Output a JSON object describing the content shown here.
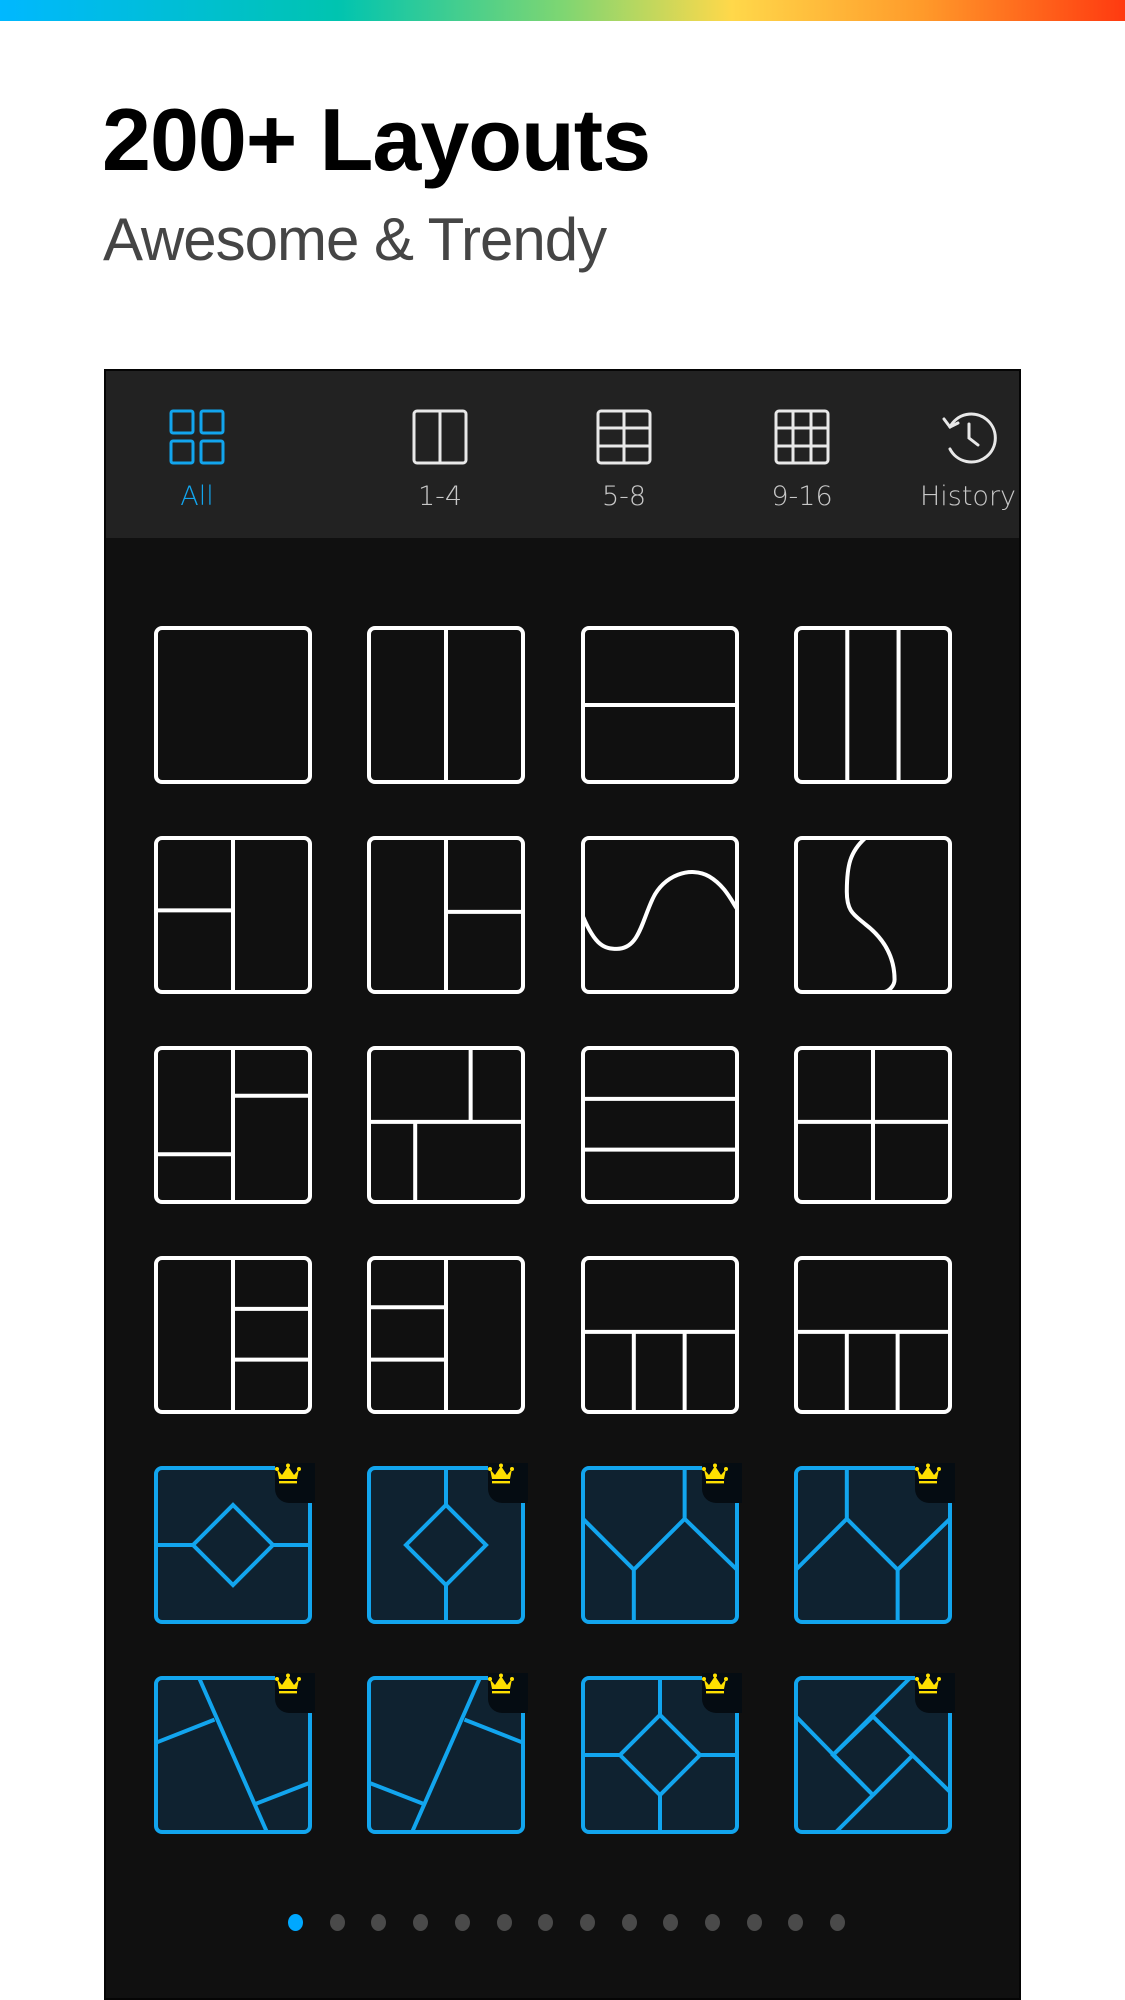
{
  "header": {
    "title": "200+ Layouts",
    "subtitle": "Awesome & Trendy"
  },
  "colors": {
    "accent": "#12a5ee",
    "premium_tile_fill": "#0f2230",
    "free_tile_stroke": "#ffffff",
    "crown": "#ffe000",
    "panel_bg": "#101010",
    "tabbar_bg": "#222222",
    "dot_inactive": "#4a4a4a",
    "dot_active": "#00a8ff"
  },
  "tabs": [
    {
      "label": "All",
      "icon": "grid-2x2-icon",
      "active": true
    },
    {
      "label": "1-4",
      "icon": "grid-1x2-icon",
      "active": false
    },
    {
      "label": "5-8",
      "icon": "grid-2x3-icon",
      "active": false
    },
    {
      "label": "9-16",
      "icon": "grid-3x3-icon",
      "active": false
    },
    {
      "label": "History",
      "icon": "history-clock-icon",
      "active": false
    }
  ],
  "layouts": [
    {
      "id": "single",
      "premium": false
    },
    {
      "id": "two-columns",
      "premium": false
    },
    {
      "id": "two-rows",
      "premium": false
    },
    {
      "id": "three-columns",
      "premium": false
    },
    {
      "id": "left-split-right-full",
      "premium": false
    },
    {
      "id": "left-full-right-split",
      "premium": false
    },
    {
      "id": "wave-horizontal",
      "premium": false
    },
    {
      "id": "wave-vertical",
      "premium": false
    },
    {
      "id": "left-split-right-split-offset",
      "premium": false
    },
    {
      "id": "four-offset",
      "premium": false
    },
    {
      "id": "three-rows",
      "premium": false
    },
    {
      "id": "four-grid",
      "premium": false
    },
    {
      "id": "left-full-right-three",
      "premium": false
    },
    {
      "id": "left-three-right-full",
      "premium": false
    },
    {
      "id": "top-full-bottom-three",
      "premium": false
    },
    {
      "id": "top-full-bottom-three-alt",
      "premium": false
    },
    {
      "id": "diamond-horizontal",
      "premium": true
    },
    {
      "id": "diamond-vertical",
      "premium": true
    },
    {
      "id": "y-shape-left",
      "premium": true
    },
    {
      "id": "y-shape-right",
      "premium": true
    },
    {
      "id": "diagonal-left",
      "premium": true
    },
    {
      "id": "diagonal-right",
      "premium": true
    },
    {
      "id": "diamond-cross",
      "premium": true
    },
    {
      "id": "pinwheel-diagonal",
      "premium": true
    }
  ],
  "pagination": {
    "total_pages": 14,
    "current_page": 1
  }
}
